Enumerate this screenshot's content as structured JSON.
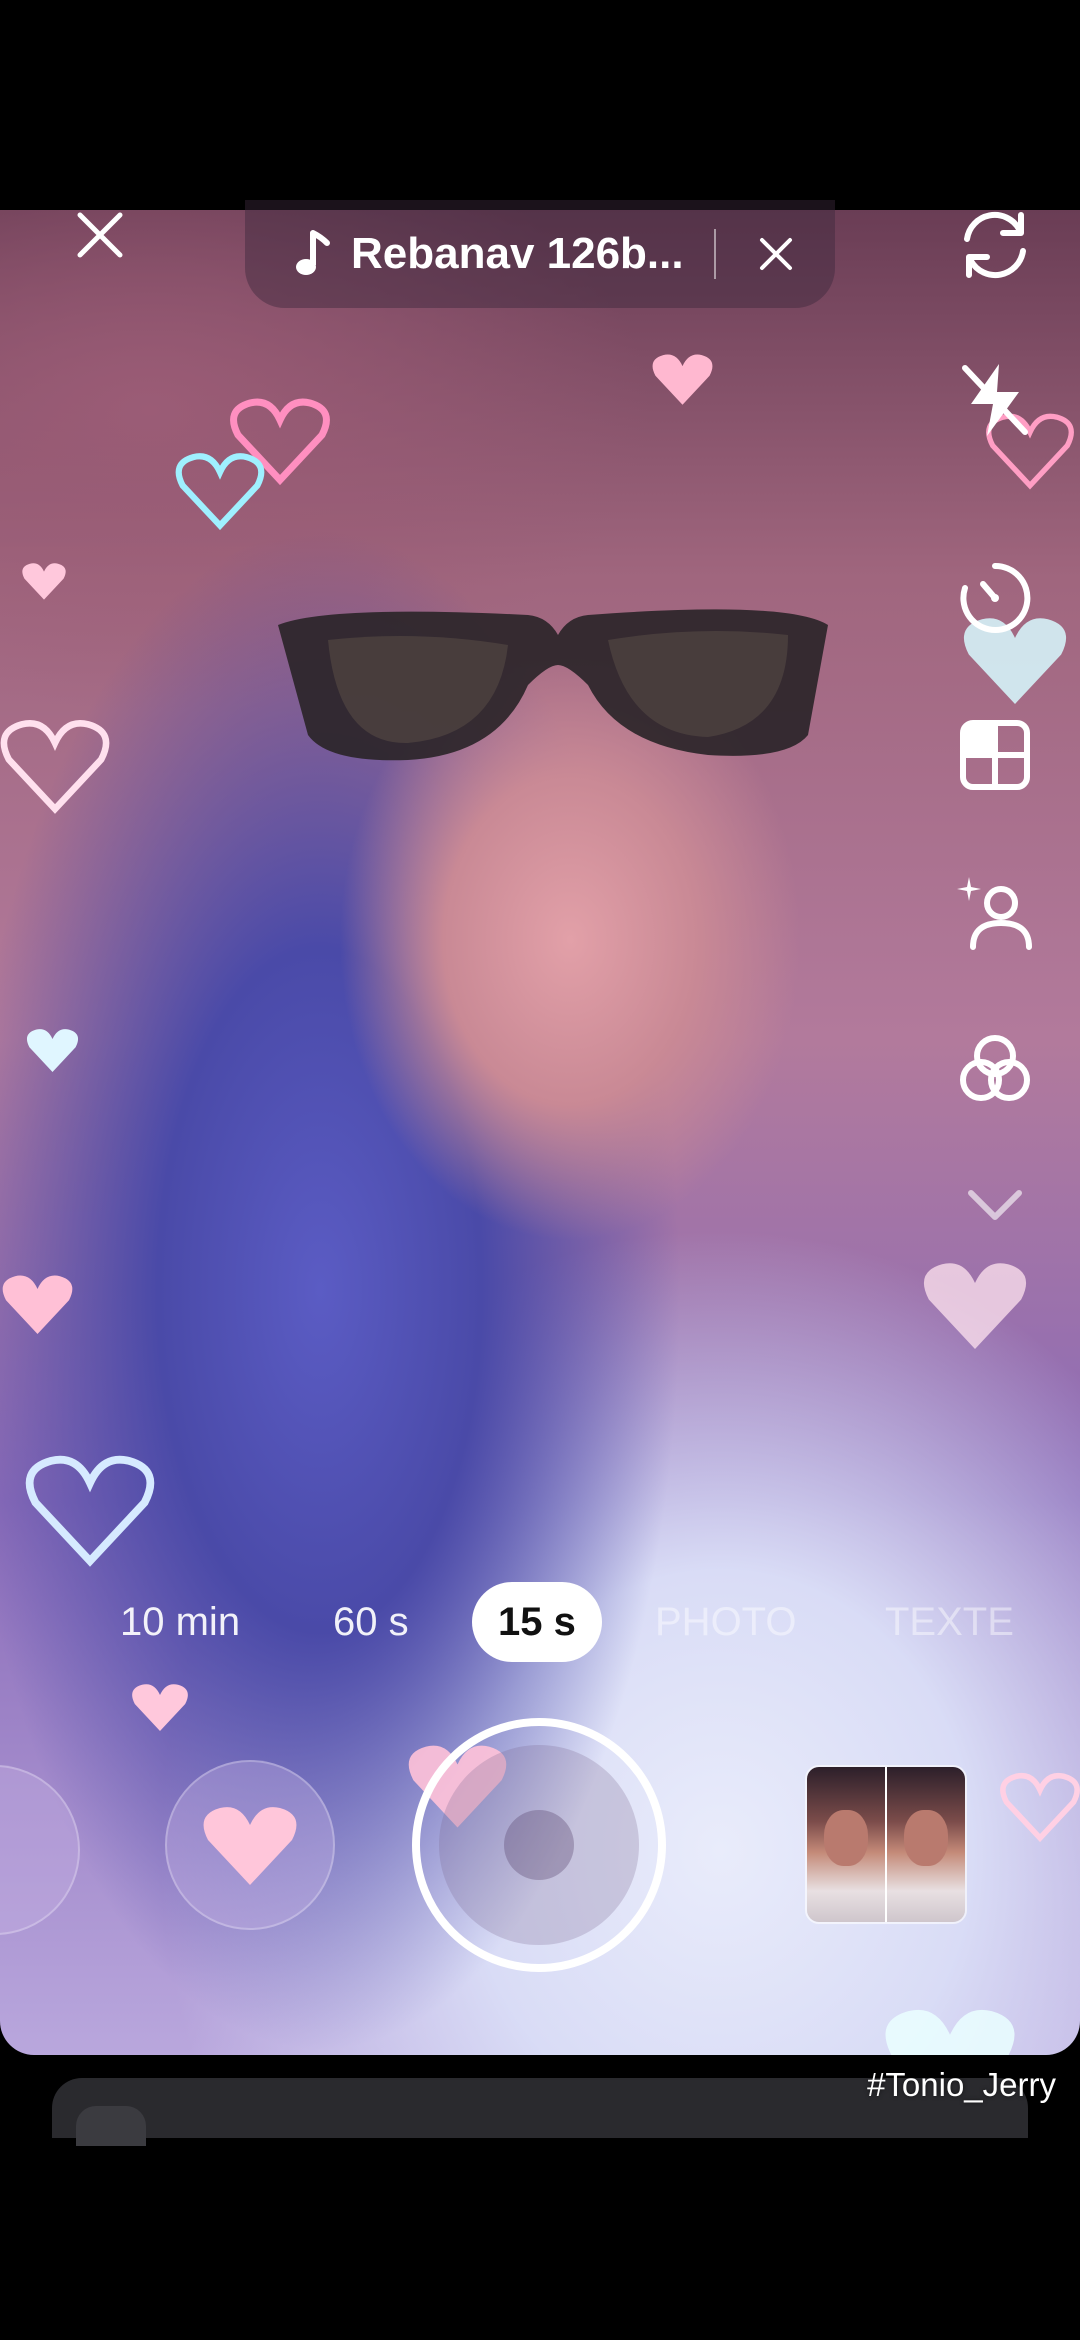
{
  "music": {
    "title": "Rebanav 126b..."
  },
  "modes": [
    {
      "label": "10 min",
      "state": "normal"
    },
    {
      "label": "60 s",
      "state": "normal"
    },
    {
      "label": "15 s",
      "state": "selected"
    },
    {
      "label": "PHOTO",
      "state": "faded"
    },
    {
      "label": "TEXTE",
      "state": "faded"
    }
  ],
  "rail_icons": [
    "flip-camera-icon",
    "flash-off-icon",
    "timer-icon",
    "layout-grid-icon",
    "beauty-icon",
    "filters-icon",
    "chevron-down-icon"
  ],
  "watermark": "#Tonio_Jerry",
  "colors": {
    "accent": "#ffffff",
    "overlay": "#3c283c"
  }
}
